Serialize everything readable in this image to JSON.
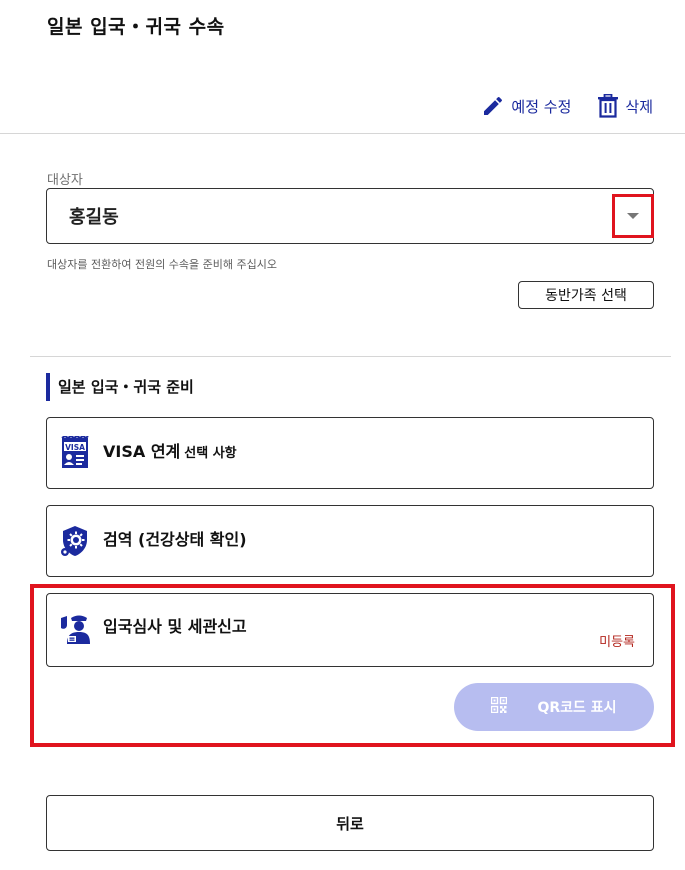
{
  "header": {
    "title": "일본 입국・귀국 수속"
  },
  "actions": {
    "edit_label": "예정 수정",
    "delete_label": "삭제"
  },
  "target": {
    "label": "대상자",
    "selected": "홍길동",
    "helper": "대상자를 전환하여 전원의 수속을 준비해 주십시오",
    "companion_button": "동반가족 선택"
  },
  "section": {
    "title": "일본 입국・귀국 준비"
  },
  "cards": [
    {
      "title": "VISA 연계",
      "subtitle": "선택 사항",
      "icon": "visa-icon"
    },
    {
      "title": "검역 (건강상태 확인)",
      "icon": "quarantine-icon"
    },
    {
      "title": "입국심사 및 세관신고",
      "status": "미등록",
      "icon": "customs-officer-icon"
    }
  ],
  "qr_button": {
    "label": "QR코드 표시",
    "icon": "qr-code-icon"
  },
  "back_button": {
    "label": "뒤로"
  },
  "colors": {
    "accent": "#1b2a9e",
    "highlight": "#e0141e",
    "status_unregistered": "#b3261e",
    "qr_button_disabled": "#b7bdf0"
  }
}
